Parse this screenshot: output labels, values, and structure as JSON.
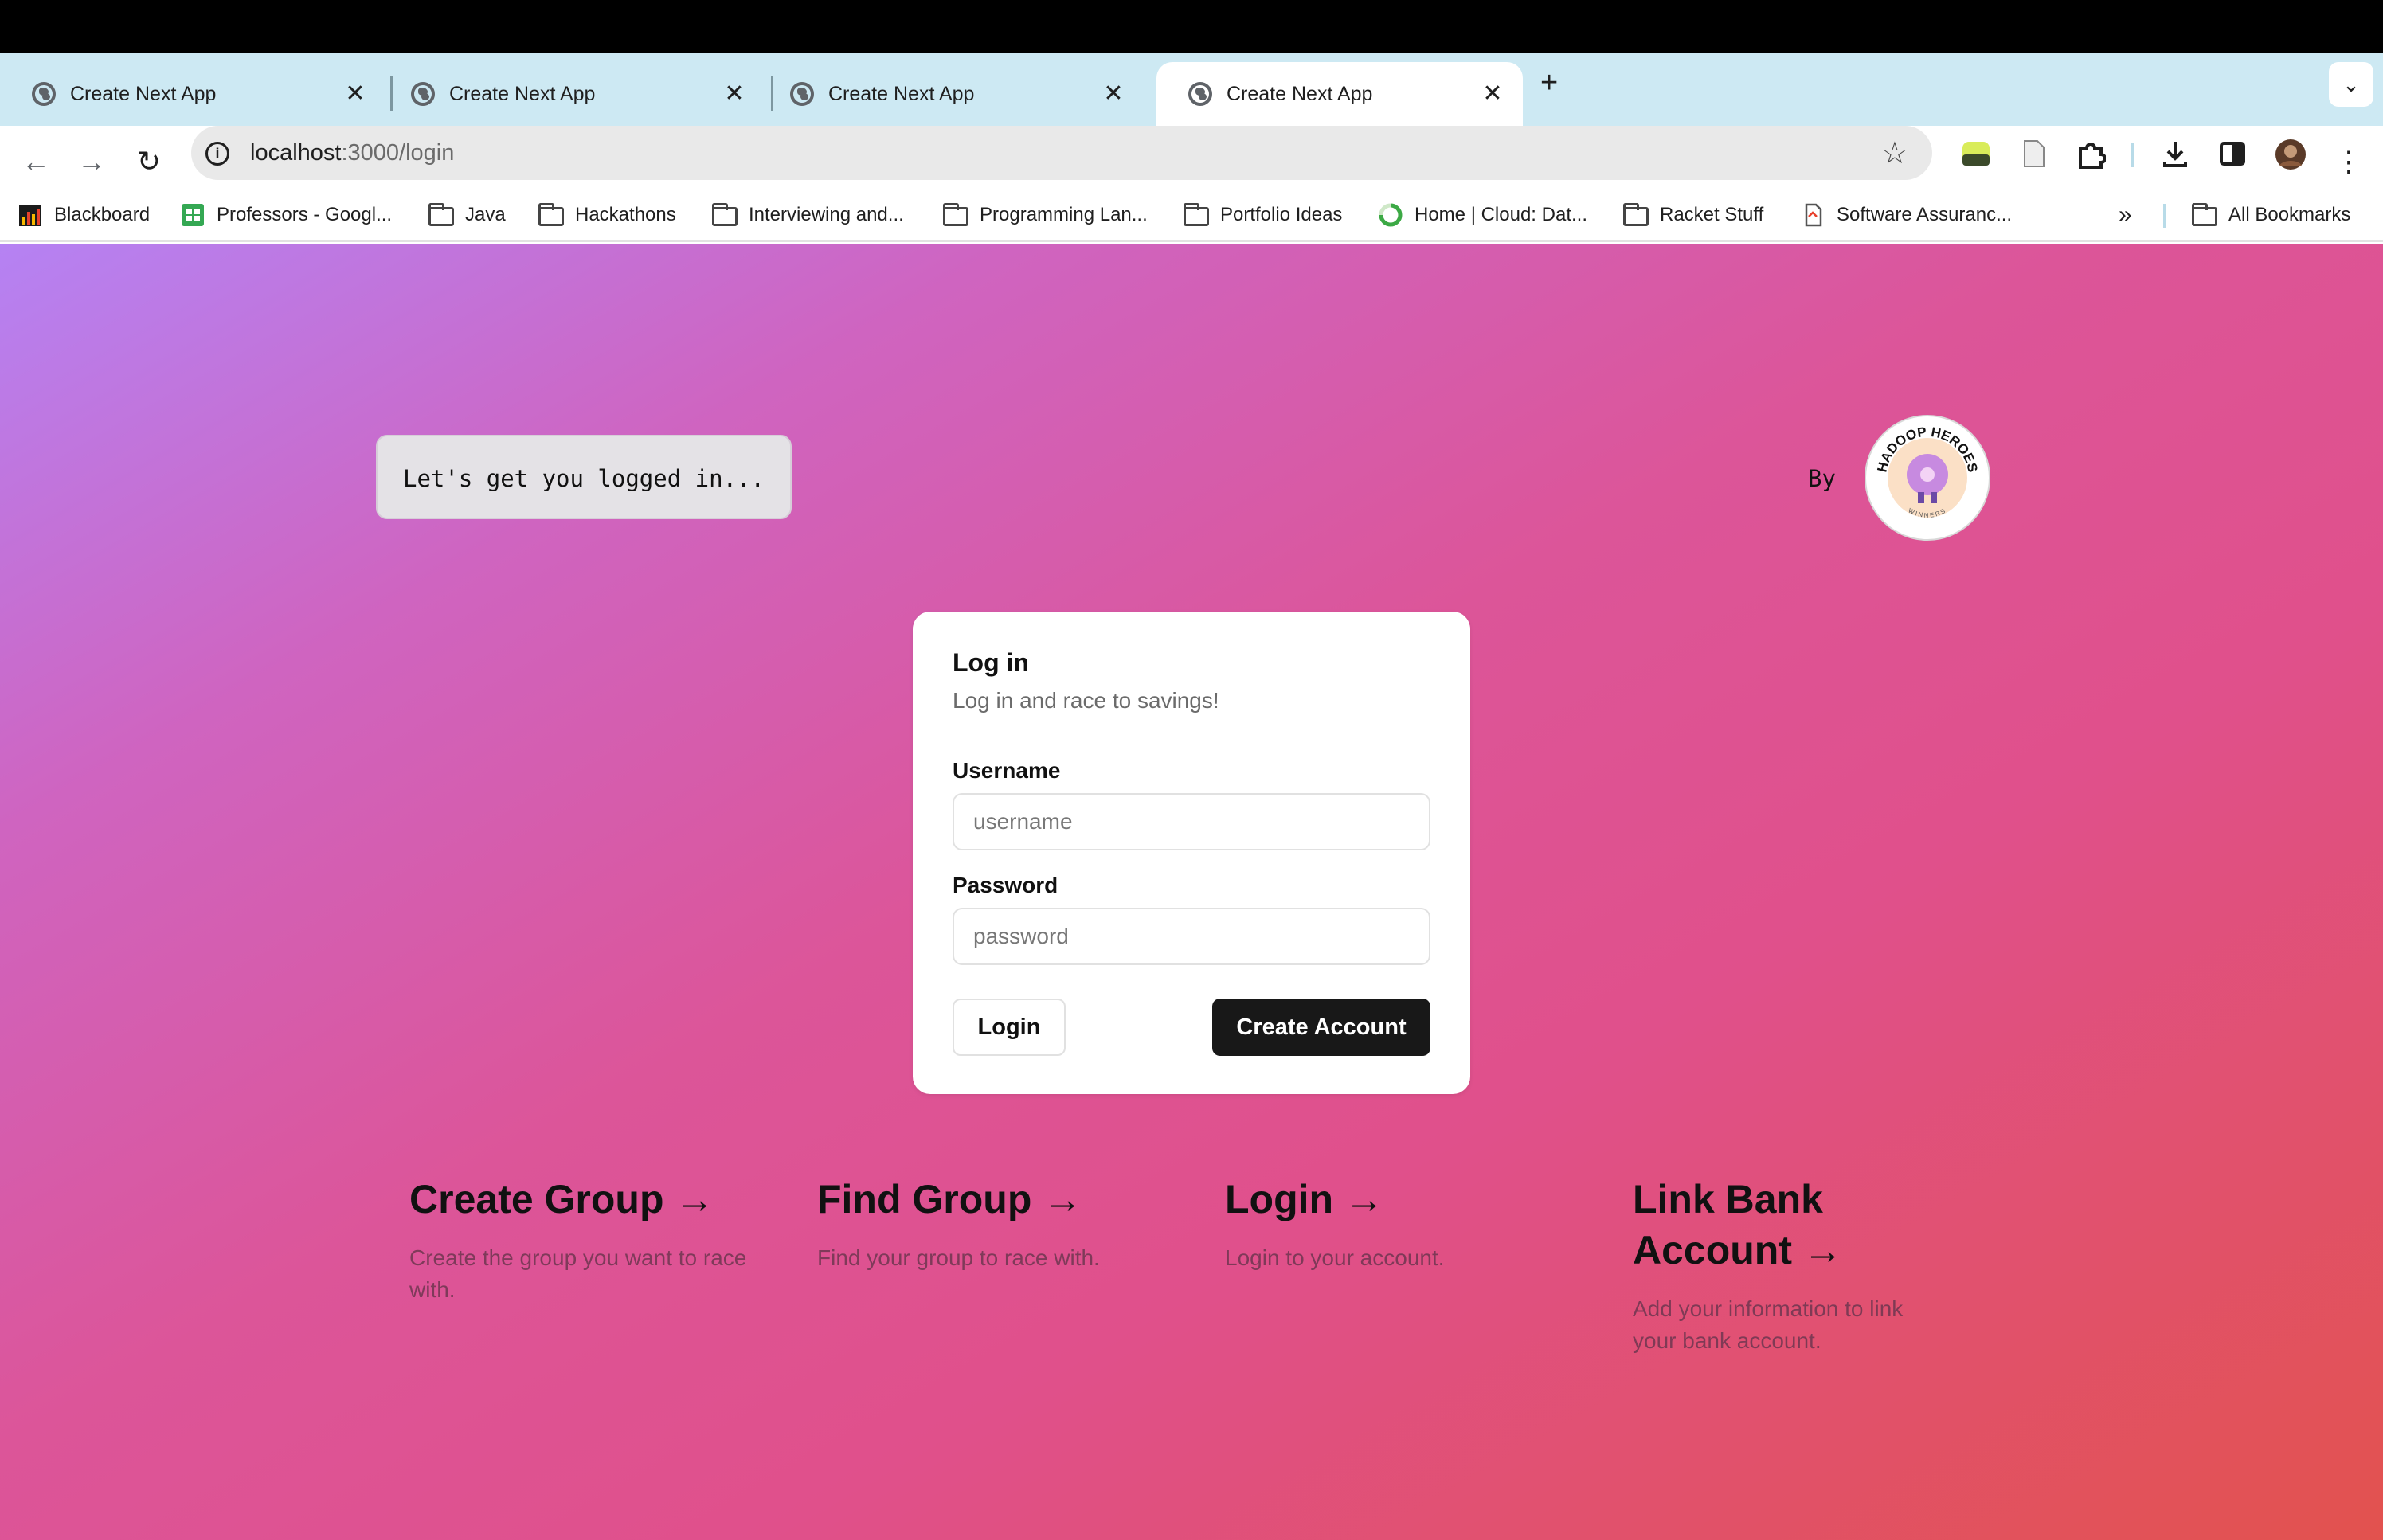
{
  "browser": {
    "tabs": [
      {
        "title": "Create Next App",
        "active": false
      },
      {
        "title": "Create Next App",
        "active": false
      },
      {
        "title": "Create Next App",
        "active": false
      },
      {
        "title": "Create Next App",
        "active": true
      }
    ],
    "new_tab_label": "+",
    "url_host": "localhost",
    "url_path": ":3000/login",
    "bookmarks": [
      {
        "label": "Blackboard",
        "icon": "bar-chart-icon"
      },
      {
        "label": "Professors - Googl...",
        "icon": "google-sheets-icon"
      },
      {
        "label": "Java",
        "icon": "folder-icon"
      },
      {
        "label": "Hackathons",
        "icon": "folder-icon"
      },
      {
        "label": "Interviewing and...",
        "icon": "folder-icon"
      },
      {
        "label": "Programming Lan...",
        "icon": "folder-icon"
      },
      {
        "label": "Portfolio Ideas",
        "icon": "folder-icon"
      },
      {
        "label": "Home | Cloud: Dat...",
        "icon": "spinner-icon"
      },
      {
        "label": "Racket Stuff",
        "icon": "folder-icon"
      },
      {
        "label": "Software Assuranc...",
        "icon": "doc-icon"
      }
    ],
    "bookmarks_overflow": "»",
    "all_bookmarks": "All Bookmarks"
  },
  "page": {
    "greeting": "Let's get you logged in...",
    "by_label": "By",
    "logo_text": "HADOOP HEROES",
    "logo_subtext": "WINNERS",
    "login_card": {
      "title": "Log in",
      "subtitle": "Log in and race to savings!",
      "username_label": "Username",
      "username_placeholder": "username",
      "password_label": "Password",
      "password_placeholder": "password",
      "login_button": "Login",
      "create_button": "Create Account"
    },
    "links": [
      {
        "title": "Create Group →",
        "desc": "Create the group you want to race with."
      },
      {
        "title": "Find Group →",
        "desc": "Find your group to race with."
      },
      {
        "title": "Login →",
        "desc": "Login to your account."
      },
      {
        "title": "Link Bank Account →",
        "desc": "Add your information to link your bank account."
      }
    ]
  }
}
